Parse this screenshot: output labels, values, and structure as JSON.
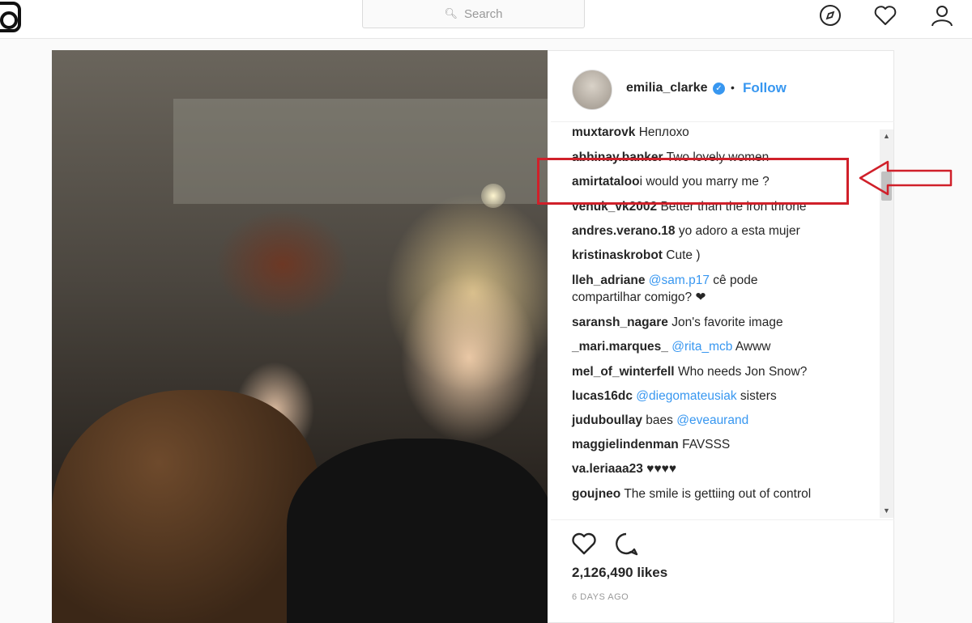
{
  "topbar": {
    "search_placeholder": "Search",
    "search_icon": "search-icon",
    "icons": [
      "compass-icon",
      "heart-icon",
      "user-icon"
    ]
  },
  "post": {
    "username": "emilia_clarke",
    "verified": true,
    "separator": "•",
    "follow_label": "Follow",
    "likes": "2,126,490 likes",
    "date": "6 DAYS AGO"
  },
  "comments": [
    {
      "user": "muxtarovk",
      "text": "Неплохо"
    },
    {
      "user": "abhinay.banker",
      "text": "Two lovely women"
    },
    {
      "user": "amirtataloo",
      "text": "i would you marry me ?"
    },
    {
      "user": "venuk_vk2002",
      "text": "Better than the iron throne"
    },
    {
      "user": "andres.verano.18",
      "text": "yo adoro a esta mujer"
    },
    {
      "user": "kristinaskrobot",
      "text": "Cute )"
    },
    {
      "user": "lleh_adriane",
      "mention": "@sam.p17",
      "text": "cê pode compartilhar comigo? ❤"
    },
    {
      "user": "saransh_nagare",
      "text": "Jon's favorite image"
    },
    {
      "user": "_mari.marques_",
      "mention": "@rita_mcb",
      "text": "Awww"
    },
    {
      "user": "mel_of_winterfell",
      "text": "Who needs Jon Snow?"
    },
    {
      "user": "lucas16dc",
      "mention": "@diegomateusiak",
      "text": "sisters"
    },
    {
      "user": "juduboullay",
      "text": "baes",
      "mention_after": "@eveaurand"
    },
    {
      "user": "maggielindenman",
      "text": "FAVSSS"
    },
    {
      "user": "va.leriaaa23",
      "text": "♥♥♥♥"
    },
    {
      "user": "goujneo",
      "text": "The smile is gettiing out of control"
    }
  ],
  "colors": {
    "link_blue": "#3897f0",
    "annotation_red": "#d0202a"
  }
}
